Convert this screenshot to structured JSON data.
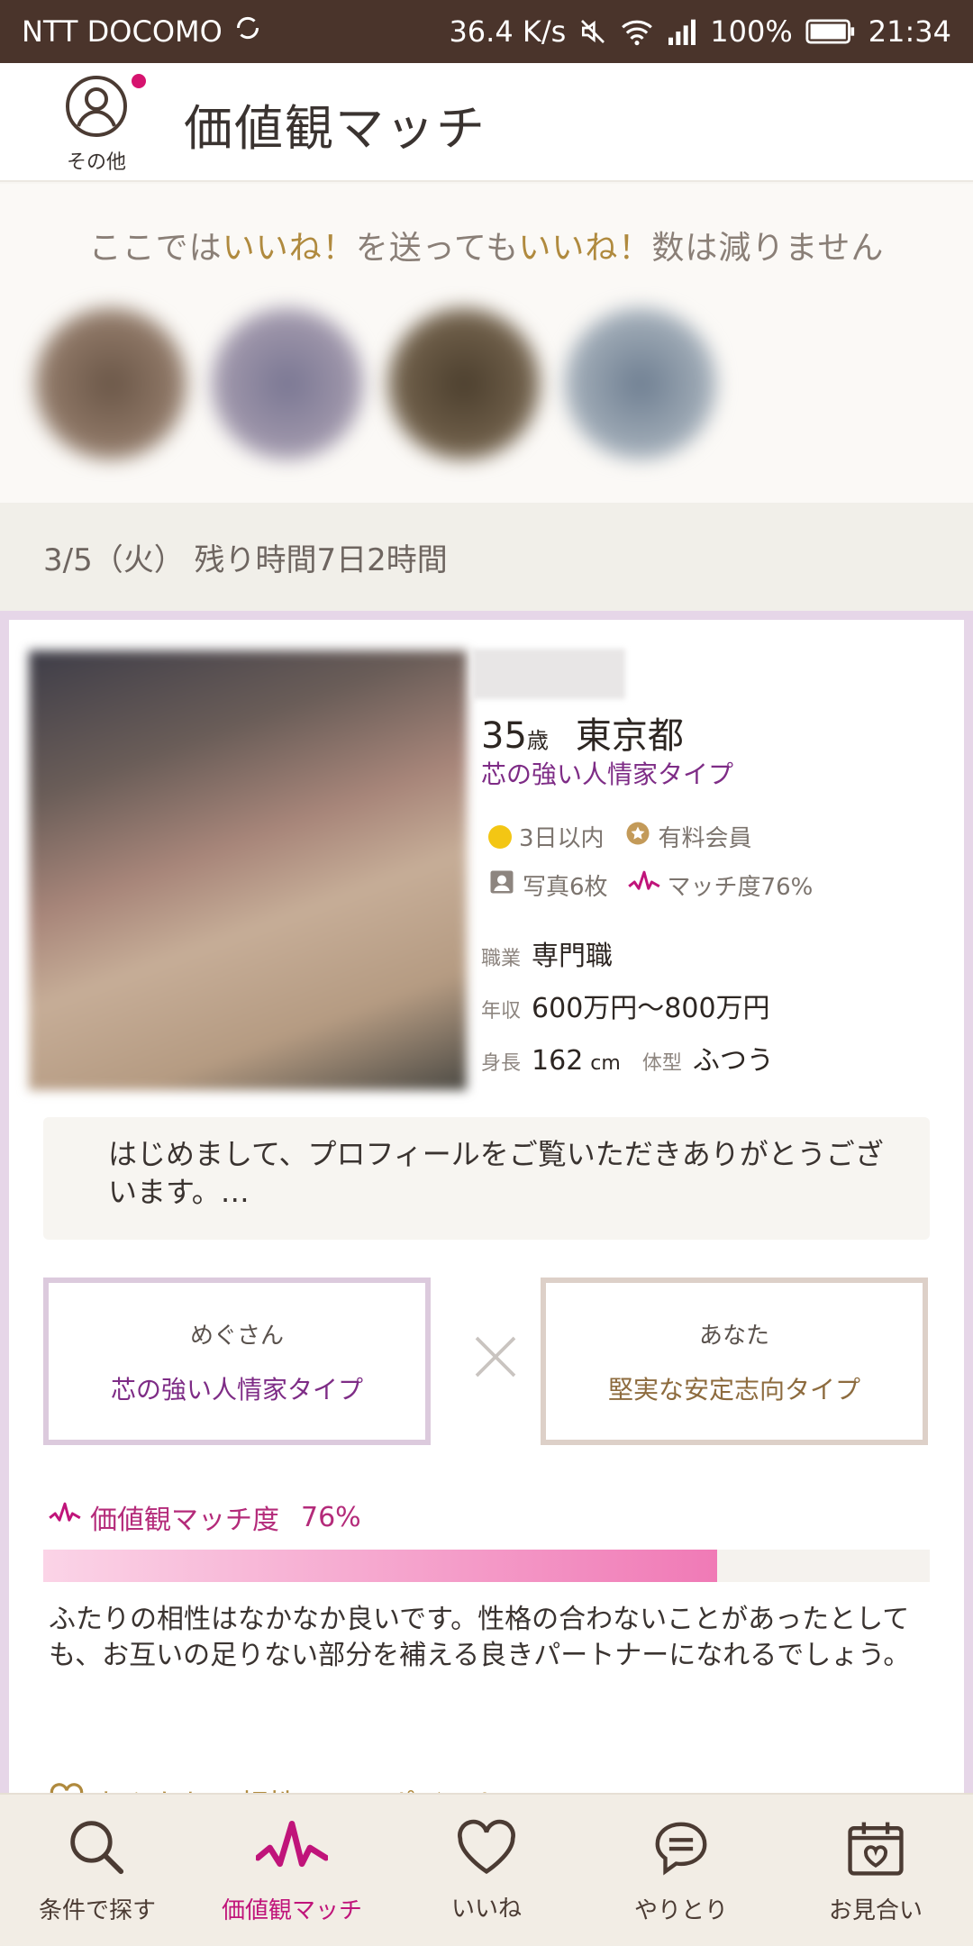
{
  "status_bar": {
    "carrier": "NTT DOCOMO",
    "speed": "36.4 K/s",
    "battery": "100%",
    "time": "21:34"
  },
  "header": {
    "other_label": "その他",
    "title": "価値観マッチ"
  },
  "like_banner": {
    "text_1": "ここでは",
    "accent_1": "いいね！",
    "text_2": "を送っても",
    "accent_2": "いいね！",
    "text_3": "数は減りません"
  },
  "date_row": {
    "text": "3/5（火） 残り時間7日2時間"
  },
  "profile": {
    "age": "35",
    "age_unit": "歳",
    "location": "東京都",
    "type": "芯の強い人情家タイプ",
    "login": "3日以内",
    "membership": "有料会員",
    "photos": "写真6枚",
    "match": "マッチ度76%",
    "job_label": "職業",
    "job": "専門職",
    "income_label": "年収",
    "income": "600万円〜800万円",
    "height_label": "身長",
    "height": "162",
    "height_unit": "cm",
    "body_label": "体型",
    "body": "ふつう"
  },
  "message": "はじめまして、プロフィールをご覧いただきありがとうございます。…",
  "compare": {
    "left_name": "めぐさん",
    "left_type": "芯の強い人情家タイプ",
    "right_name": "あなた",
    "right_type": "堅実な安定志向タイプ"
  },
  "match_section": {
    "label": "価値観マッチ度",
    "percent_text": "76%",
    "percent": 0.76,
    "description": "ふたりの相性はなかなか良いです。性格の合わないことがあったとしても、お互いの足りない部分を補える良きパートナーになれるでしょう。",
    "good_points": "おふたりの相性GOODポイント"
  },
  "bottom_nav": [
    {
      "label": "条件で探す",
      "icon": "search-icon"
    },
    {
      "label": "価値観マッチ",
      "icon": "pulse-icon"
    },
    {
      "label": "いいね",
      "icon": "heart-icon"
    },
    {
      "label": "やりとり",
      "icon": "chat-icon"
    },
    {
      "label": "お見合い",
      "icon": "calendar-heart-icon"
    }
  ],
  "colors": {
    "accent_pink": "#c0147a",
    "accent_purple": "#7e2c86",
    "gold": "#b08a3e",
    "status_bar": "#4a342b"
  }
}
